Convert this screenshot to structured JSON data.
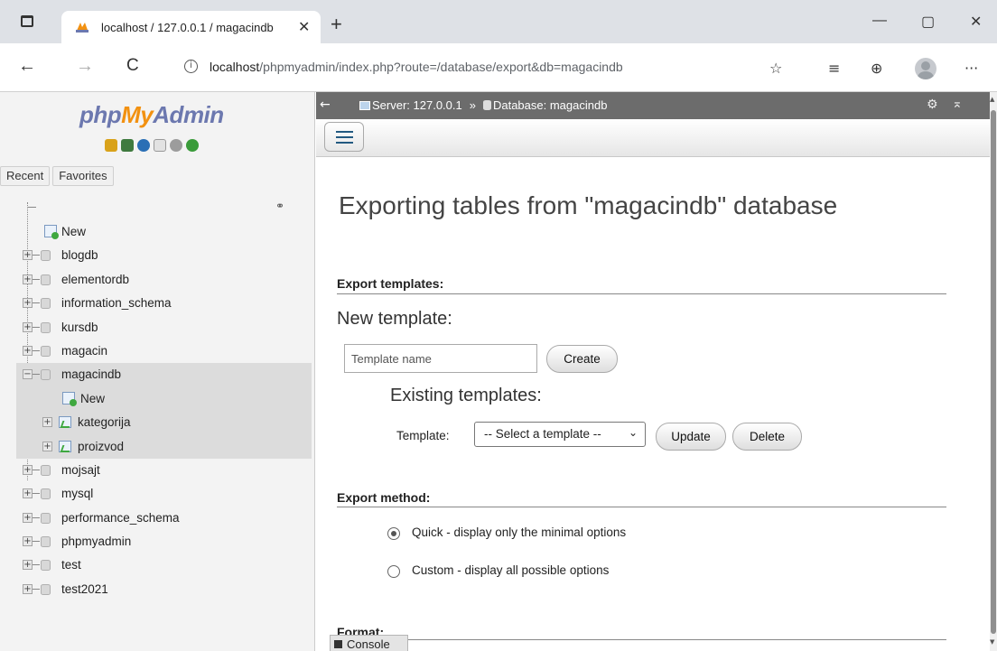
{
  "browser": {
    "tab_title": "localhost / 127.0.0.1 / magacindb",
    "tab_close": "✕",
    "new_tab": "+",
    "window_controls": {
      "minimize": "—",
      "maximize": "▢",
      "close": "✕"
    },
    "nav": {
      "back": "←",
      "forward": "→",
      "reload": "C"
    },
    "info": "i",
    "url_host": "localhost",
    "url_path": "/phpmyadmin/index.php?route=/database/export&db=magacindb",
    "toolbar_icons": {
      "add_favorite": "☆",
      "favorites": "≡",
      "collections": "⊕",
      "more": "···"
    }
  },
  "sidebar": {
    "logo": {
      "php": "php",
      "my": "My",
      "admin": "Admin"
    },
    "quick_icons": [
      "home-icon",
      "logout-icon",
      "help-icon",
      "docs-icon",
      "settings-icon",
      "reload-icon"
    ],
    "recent": "Recent",
    "favorites": "Favorites",
    "link_icon": "⚭",
    "tree": [
      {
        "label": "New",
        "type": "new",
        "level": 0
      },
      {
        "label": "blogdb",
        "type": "db",
        "level": 0
      },
      {
        "label": "elementordb",
        "type": "db",
        "level": 0
      },
      {
        "label": "information_schema",
        "type": "db",
        "level": 0
      },
      {
        "label": "kursdb",
        "type": "db",
        "level": 0
      },
      {
        "label": "magacin",
        "type": "db",
        "level": 0
      },
      {
        "label": "magacindb",
        "type": "db",
        "level": 0,
        "expanded": true
      },
      {
        "label": "New",
        "type": "new",
        "level": 1
      },
      {
        "label": "kategorija",
        "type": "table",
        "level": 1
      },
      {
        "label": "proizvod",
        "type": "table",
        "level": 1
      },
      {
        "label": "mojsajt",
        "type": "db",
        "level": 0
      },
      {
        "label": "mysql",
        "type": "db",
        "level": 0
      },
      {
        "label": "performance_schema",
        "type": "db",
        "level": 0
      },
      {
        "label": "phpmyadmin",
        "type": "db",
        "level": 0
      },
      {
        "label": "test",
        "type": "db",
        "level": 0
      },
      {
        "label": "test2021",
        "type": "db",
        "level": 0
      }
    ]
  },
  "topbar": {
    "collapse": "←",
    "server": "Server: 127.0.0.1",
    "separator": "»",
    "database": "Database: magacindb",
    "settings_icon": "⚙",
    "scroll_top_icon": "⌅"
  },
  "main": {
    "title": "Exporting tables from \"magacindb\" database",
    "export_templates": {
      "heading": "Export templates:",
      "new_template": "New template:",
      "name_placeholder": "Template name",
      "create": "Create",
      "existing_templates": "Existing templates:",
      "template_label": "Template:",
      "template_select": "-- Select a template --",
      "update": "Update",
      "delete": "Delete"
    },
    "export_method": {
      "heading": "Export method:",
      "options": [
        {
          "label": "Quick - display only the minimal options",
          "checked": true
        },
        {
          "label": "Custom - display all possible options",
          "checked": false
        }
      ]
    },
    "format_heading": "Format:",
    "console": "Console"
  },
  "colors": {
    "logo_blue": "#6c78af",
    "logo_orange": "#f29111",
    "topbar": "#6c6c6c",
    "sidebar_bg": "#f3f3f3",
    "selected_row": "#dcdcdc"
  }
}
